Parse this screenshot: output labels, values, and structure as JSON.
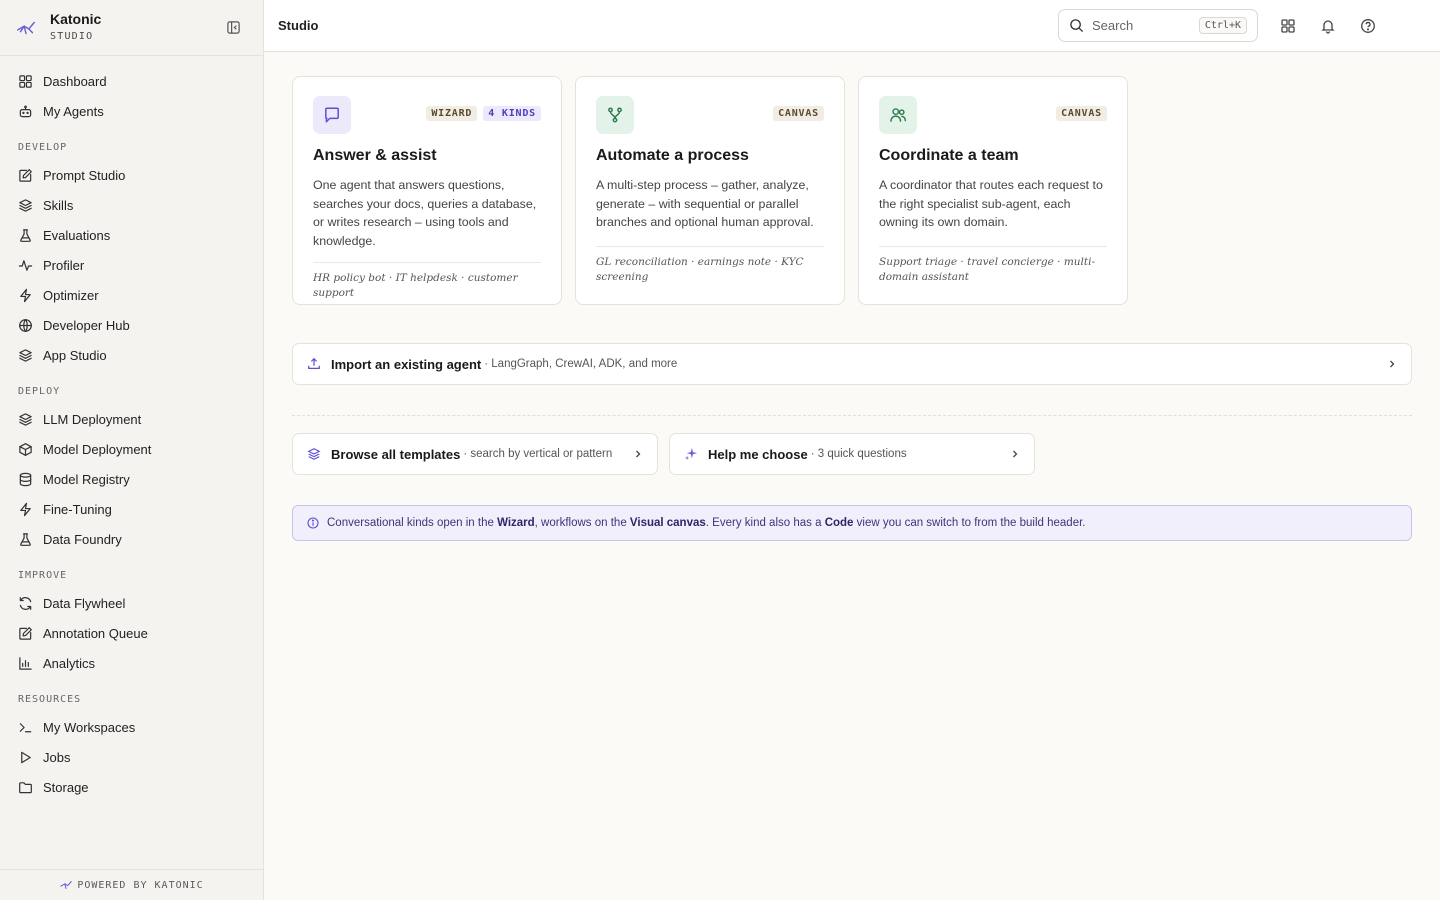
{
  "brand": {
    "name": "Katonic",
    "sub": "STUDIO"
  },
  "sidebar": {
    "top_items": [
      {
        "label": "Dashboard",
        "icon": "grid-icon"
      },
      {
        "label": "My Agents",
        "icon": "bot-icon"
      }
    ],
    "sections": [
      {
        "title": "DEVELOP",
        "items": [
          {
            "label": "Prompt Studio",
            "icon": "edit-icon"
          },
          {
            "label": "Skills",
            "icon": "layers-icon"
          },
          {
            "label": "Evaluations",
            "icon": "flask-icon"
          },
          {
            "label": "Profiler",
            "icon": "activity-icon"
          },
          {
            "label": "Optimizer",
            "icon": "zap-icon"
          },
          {
            "label": "Developer Hub",
            "icon": "globe-icon"
          },
          {
            "label": "App Studio",
            "icon": "layers-icon"
          }
        ]
      },
      {
        "title": "DEPLOY",
        "items": [
          {
            "label": "LLM Deployment",
            "icon": "layers-icon"
          },
          {
            "label": "Model Deployment",
            "icon": "box-icon"
          },
          {
            "label": "Model Registry",
            "icon": "database-icon"
          },
          {
            "label": "Fine-Tuning",
            "icon": "zap-icon"
          },
          {
            "label": "Data Foundry",
            "icon": "flask-icon"
          }
        ]
      },
      {
        "title": "IMPROVE",
        "items": [
          {
            "label": "Data Flywheel",
            "icon": "refresh-icon"
          },
          {
            "label": "Annotation Queue",
            "icon": "edit-icon"
          },
          {
            "label": "Analytics",
            "icon": "bar-chart-icon"
          }
        ]
      },
      {
        "title": "RESOURCES",
        "items": [
          {
            "label": "My Workspaces",
            "icon": "terminal-icon"
          },
          {
            "label": "Jobs",
            "icon": "play-icon"
          },
          {
            "label": "Storage",
            "icon": "folder-icon"
          }
        ]
      }
    ],
    "footer": "POWERED BY KATONIC"
  },
  "topbar": {
    "title": "Studio",
    "search_placeholder": "Search",
    "search_shortcut": "Ctrl+K"
  },
  "cards": [
    {
      "icon": "chat-icon",
      "icon_bg": "#ece9fb",
      "icon_color": "#5b4fd6",
      "tags": [
        "WIZARD",
        "4 KINDS"
      ],
      "title": "Answer & assist",
      "desc": "One agent that answers questions, searches your docs, queries a database, or writes research – using tools and knowledge.",
      "examples": "HR policy bot · IT helpdesk · customer support"
    },
    {
      "icon": "git-branch-icon",
      "icon_bg": "#e4f3ea",
      "icon_color": "#2f7a4d",
      "tags": [
        "CANVAS"
      ],
      "title": "Automate a process",
      "desc": "A multi-step process – gather, analyze, generate – with sequential or parallel branches and optional human approval.",
      "examples": "GL reconciliation · earnings note · KYC screening"
    },
    {
      "icon": "users-icon",
      "icon_bg": "#e4f3ea",
      "icon_color": "#2f7a4d",
      "tags": [
        "CANVAS"
      ],
      "title": "Coordinate a team",
      "desc": "A coordinator that routes each request to the right specialist sub-agent, each owning its own domain.",
      "examples": "Support triage · travel concierge · multi-domain assistant"
    }
  ],
  "import_row": {
    "title": "Import an existing agent",
    "sub": "· LangGraph, CrewAI, ADK, and more"
  },
  "browse_row": {
    "title": "Browse all templates",
    "sub": "· search by vertical or pattern"
  },
  "help_row": {
    "title": "Help me choose",
    "sub": "· 3 quick questions"
  },
  "info": {
    "p1": "Conversational kinds open in the ",
    "b1": "Wizard",
    "p2": ", workflows on the ",
    "b2": "Visual canvas",
    "p3": ". Every kind also has a ",
    "b3": "Code",
    "p4": " view you can switch to from the build header."
  }
}
